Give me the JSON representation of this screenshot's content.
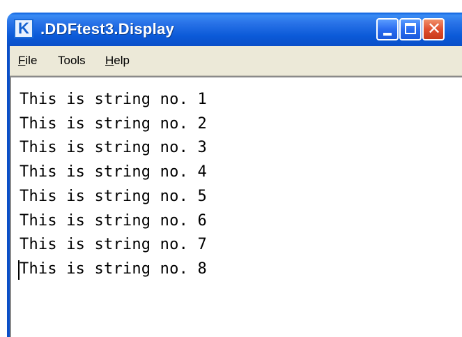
{
  "window": {
    "app_icon_letter": "K",
    "title": ".DDFtest3.Display"
  },
  "menubar": {
    "items": [
      {
        "label": "File",
        "accel": "F",
        "rest": "ile"
      },
      {
        "label": "Tools"
      },
      {
        "label": "Help",
        "accel": "H",
        "rest": "elp"
      }
    ]
  },
  "content": {
    "lines": [
      "This is string no. 1",
      "This is string no. 2",
      "This is string no. 3",
      "This is string no. 4",
      "This is string no. 5",
      "This is string no. 6",
      "This is string no. 7",
      "This is string no. 8"
    ]
  }
}
